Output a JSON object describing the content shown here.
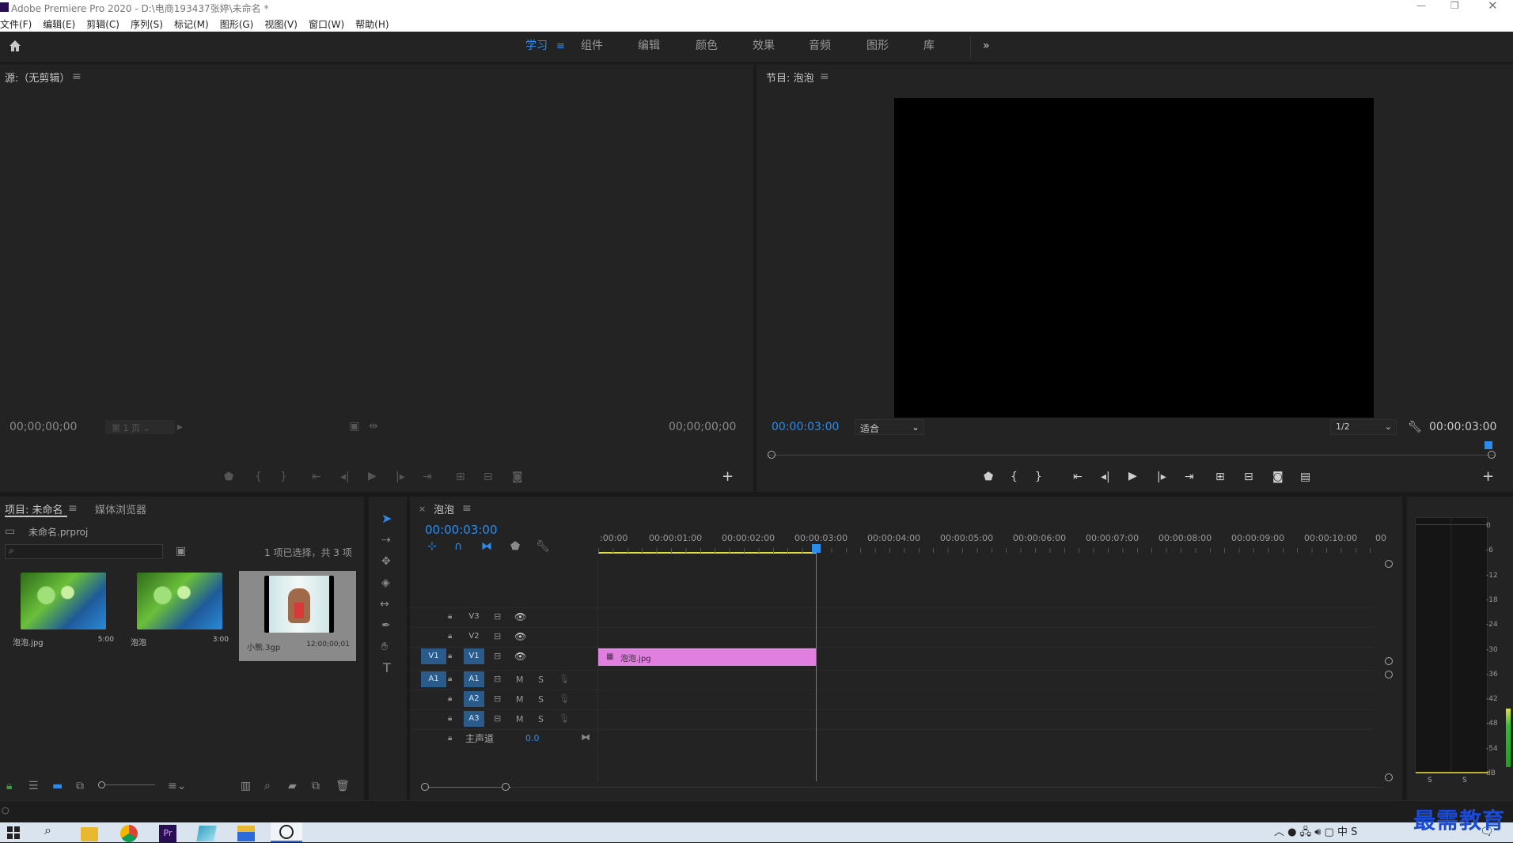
{
  "window": {
    "title": "Adobe Premiere Pro 2020 - D:\\电商193437张婷\\未命名 *"
  },
  "menu": [
    "文件(F)",
    "编辑(E)",
    "剪辑(C)",
    "序列(S)",
    "标记(M)",
    "图形(G)",
    "视图(V)",
    "窗口(W)",
    "帮助(H)"
  ],
  "workspaces": [
    "学习",
    "组件",
    "编辑",
    "颜色",
    "效果",
    "音频",
    "图形",
    "库"
  ],
  "source": {
    "title": "源:（无剪辑）",
    "tc_left": "00;00;00;00",
    "page": "第 1 页",
    "tc_right": "00;00;00;00"
  },
  "program": {
    "title": "节目: 泡泡",
    "tc": "00:00:03:00",
    "fit": "适合",
    "res": "1/2",
    "duration": "00:00:03:00"
  },
  "project": {
    "tab1": "项目: 未命名",
    "tab2": "媒体浏览器",
    "file": "未命名.prproj",
    "status": "1 项已选择，共 3 项",
    "items": [
      {
        "name": "泡泡.jpg",
        "dur": "5:00"
      },
      {
        "name": "泡泡",
        "dur": "3:00"
      },
      {
        "name": "小熊.3gp",
        "dur": "12;00;00;01"
      }
    ]
  },
  "timeline": {
    "tab": "泡泡",
    "tc": "00:00:03:00",
    "ruler": [
      ":00:00",
      "00:00:01:00",
      "00:00:02:00",
      "00:00:03:00",
      "00:00:04:00",
      "00:00:05:00",
      "00:00:06:00",
      "00:00:07:00",
      "00:00:08:00",
      "00:00:09:00",
      "00:00:10:00",
      "00"
    ],
    "tracks_v": [
      "V3",
      "V2",
      "V1"
    ],
    "tracks_a": [
      "A1",
      "A2",
      "A3"
    ],
    "src_v": "V1",
    "src_a": "A1",
    "mute": "M",
    "solo": "S",
    "master": "主声道",
    "master_val": "0.0",
    "clip": "泡泡.jpg",
    "clip_color": "#e07fe0"
  },
  "meter": {
    "scale": [
      "0",
      "-6",
      "-12",
      "-18",
      "-24",
      "-30",
      "-36",
      "-42",
      "-48",
      "-54",
      "dB"
    ],
    "solo": [
      "S",
      "S"
    ]
  },
  "watermark": "最需教育",
  "accent": "#2d8ceb"
}
